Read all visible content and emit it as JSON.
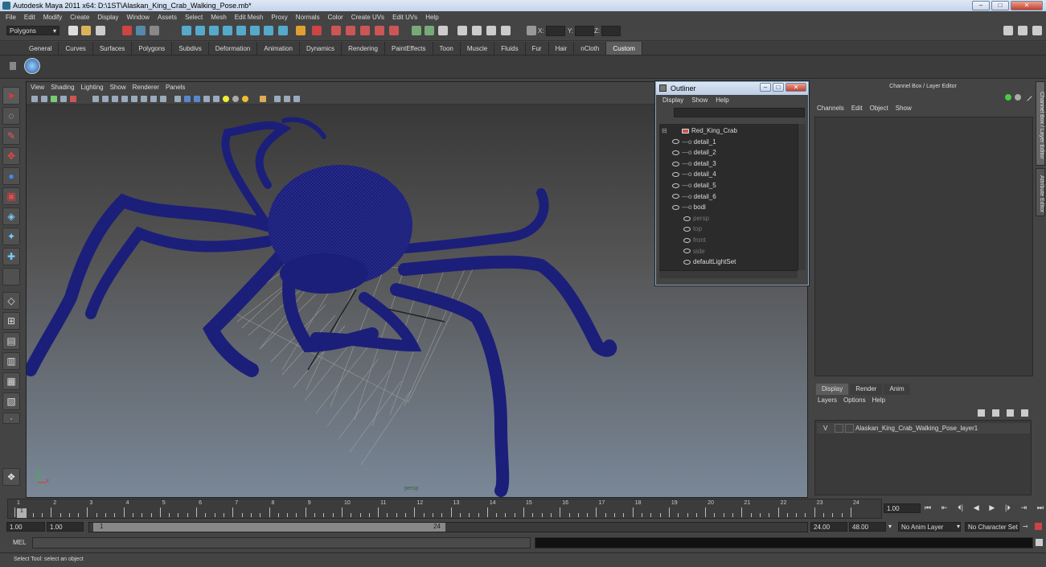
{
  "window": {
    "title": "Autodesk Maya 2011 x64: D:\\1ST\\Alaskan_King_Crab_Walking_Pose.mb*"
  },
  "menubar": [
    "File",
    "Edit",
    "Modify",
    "Create",
    "Display",
    "Window",
    "Assets",
    "Select",
    "Mesh",
    "Edit Mesh",
    "Proxy",
    "Normals",
    "Color",
    "Create UVs",
    "Edit UVs",
    "Help"
  ],
  "statusline": {
    "mode": "Polygons",
    "x_label": "X:",
    "y_label": "Y:",
    "z_label": "Z:"
  },
  "shelf_tabs": [
    "General",
    "Curves",
    "Surfaces",
    "Polygons",
    "Subdivs",
    "Deformation",
    "Animation",
    "Dynamics",
    "Rendering",
    "PaintEffects",
    "Toon",
    "Muscle",
    "Fluids",
    "Fur",
    "Hair",
    "nCloth",
    "Custom"
  ],
  "active_shelf": "Custom",
  "viewport": {
    "menu": [
      "View",
      "Shading",
      "Lighting",
      "Show",
      "Renderer",
      "Panels"
    ],
    "camera_label": "persp",
    "axis_y": "y",
    "axis_x": "x",
    "model_color": "#1b1f7a"
  },
  "outliner": {
    "title": "Outliner",
    "menu": [
      "Display",
      "Show",
      "Help"
    ],
    "items": [
      {
        "label": "Red_King_Crab",
        "dim": false
      },
      {
        "label": "detail_1",
        "dim": false
      },
      {
        "label": "detail_2",
        "dim": false
      },
      {
        "label": "detail_3",
        "dim": false
      },
      {
        "label": "detail_4",
        "dim": false
      },
      {
        "label": "detail_5",
        "dim": false
      },
      {
        "label": "detail_6",
        "dim": false
      },
      {
        "label": "bodi",
        "dim": false
      },
      {
        "label": "persp",
        "dim": true
      },
      {
        "label": "top",
        "dim": true
      },
      {
        "label": "front",
        "dim": true
      },
      {
        "label": "side",
        "dim": true
      },
      {
        "label": "defaultLightSet",
        "dim": false
      }
    ]
  },
  "channelbox": {
    "title": "Channel Box / Layer Editor",
    "menu": [
      "Channels",
      "Edit",
      "Object",
      "Show"
    ]
  },
  "sidetabs": [
    "Channel Box / Layer Editor",
    "Attribute Editor"
  ],
  "layer_editor": {
    "tabs": [
      "Display",
      "Render",
      "Anim"
    ],
    "active_tab": "Display",
    "menu": [
      "Layers",
      "Options",
      "Help"
    ],
    "layer": {
      "visibility": "V",
      "name": "Alaskan_King_Crab_Walking_Pose_layer1"
    }
  },
  "timeline": {
    "ticks": [
      "1",
      "2",
      "3",
      "4",
      "5",
      "6",
      "7",
      "8",
      "9",
      "10",
      "11",
      "12",
      "13",
      "14",
      "15",
      "16",
      "17",
      "18",
      "19",
      "20",
      "21",
      "22",
      "23",
      "24"
    ],
    "current_frame": "1",
    "current_frame_field": "1.00"
  },
  "range": {
    "start": "1.00",
    "inner_start": "1.00",
    "slider_start": "1",
    "slider_end": "24",
    "end": "24.00",
    "outer_end": "48.00",
    "anim_layer": "No Anim Layer",
    "char_set": "No Character Set"
  },
  "mel": {
    "label": "MEL"
  },
  "helpline": {
    "text": "Select Tool: select an object"
  }
}
